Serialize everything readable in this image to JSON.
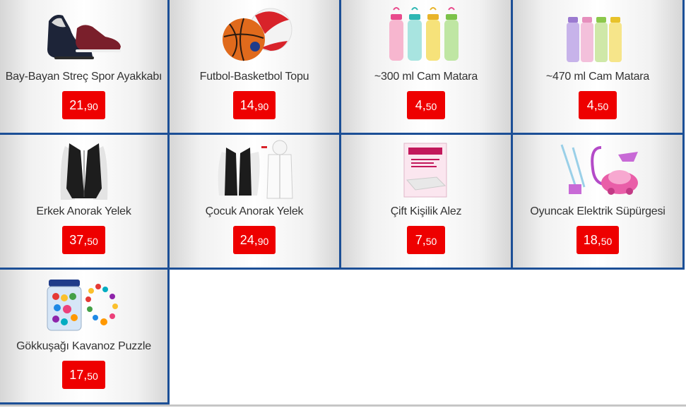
{
  "products": [
    {
      "name": "Bay-Bayan Streç Spor Ayakkabı",
      "price_int": "21",
      "price_dec": "90",
      "icon": "shoe-icon"
    },
    {
      "name": "Futbol-Basketbol Topu",
      "price_int": "14",
      "price_dec": "90",
      "icon": "ball-icon"
    },
    {
      "name": "~300 ml Cam Matara",
      "price_int": "4",
      "price_dec": "50",
      "icon": "bottle-icon"
    },
    {
      "name": "~470 ml Cam Matara",
      "price_int": "4",
      "price_dec": "50",
      "icon": "bottle-icon"
    },
    {
      "name": "Erkek Anorak Yelek",
      "price_int": "37",
      "price_dec": "50",
      "icon": "vest-icon"
    },
    {
      "name": "Çocuk Anorak Yelek",
      "price_int": "24",
      "price_dec": "90",
      "icon": "vest-icon"
    },
    {
      "name": "Çift Kişilik Alez",
      "price_int": "7",
      "price_dec": "50",
      "icon": "mattress-protector-icon"
    },
    {
      "name": "Oyuncak Elektrik Süpürgesi",
      "price_int": "18",
      "price_dec": "50",
      "icon": "toy-vacuum-icon"
    },
    {
      "name": "Gökkuşağı Kavanoz Puzzle",
      "price_int": "17",
      "price_dec": "50",
      "icon": "bead-jar-icon"
    }
  ],
  "price_comma": ",",
  "colors": {
    "border": "#1c4f96",
    "price_bg": "#ee0000",
    "price_text": "#ffffff",
    "text": "#333333"
  }
}
